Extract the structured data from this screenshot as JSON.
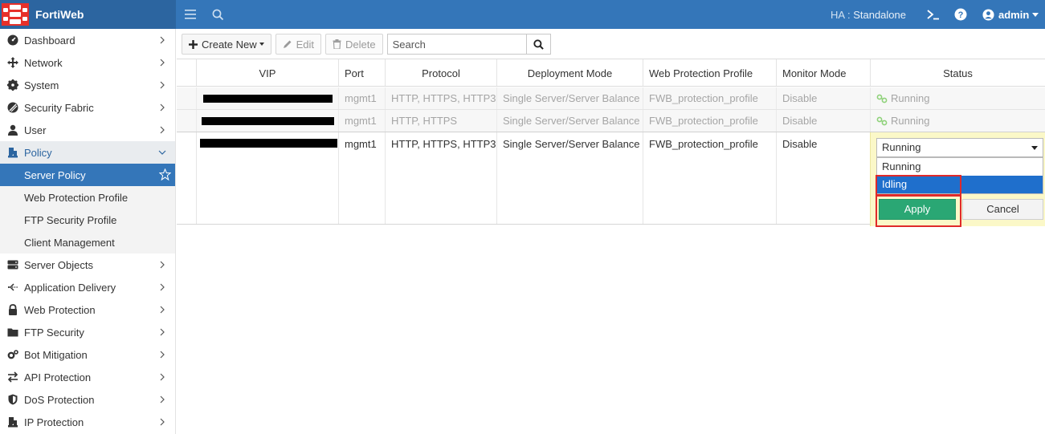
{
  "header": {
    "app_name": "FortiWeb",
    "ha_label": "HA :",
    "ha_value": "Standalone",
    "user": "admin"
  },
  "sidebar": {
    "items": [
      {
        "label": "Dashboard",
        "icon": "dashboard-icon"
      },
      {
        "label": "Network",
        "icon": "network-icon"
      },
      {
        "label": "System",
        "icon": "gear-icon"
      },
      {
        "label": "Security Fabric",
        "icon": "security-fabric-icon"
      },
      {
        "label": "User",
        "icon": "user-icon"
      },
      {
        "label": "Policy",
        "icon": "policy-icon"
      },
      {
        "label": "Server Objects",
        "icon": "server-icon"
      },
      {
        "label": "Application Delivery",
        "icon": "application-delivery-icon"
      },
      {
        "label": "Web Protection",
        "icon": "lock-icon"
      },
      {
        "label": "FTP Security",
        "icon": "folder-icon"
      },
      {
        "label": "Bot Mitigation",
        "icon": "gears-icon"
      },
      {
        "label": "API Protection",
        "icon": "exchange-icon"
      },
      {
        "label": "DoS Protection",
        "icon": "shield-icon"
      },
      {
        "label": "IP Protection",
        "icon": "ip-protection-icon"
      }
    ],
    "policy_sub": [
      {
        "label": "Server Policy"
      },
      {
        "label": "Web Protection Profile"
      },
      {
        "label": "FTP Security Profile"
      },
      {
        "label": "Client Management"
      }
    ]
  },
  "toolbar": {
    "create_new": "Create New",
    "edit": "Edit",
    "delete": "Delete",
    "search_placeholder": "Search"
  },
  "table": {
    "columns": [
      "VIP",
      "Port",
      "Protocol",
      "Deployment Mode",
      "Web Protection Profile",
      "Monitor Mode",
      "Status"
    ],
    "rows": [
      {
        "vip": "",
        "port": "mgmt1",
        "protocol": "HTTP, HTTPS, HTTP3",
        "deployment_mode": "Single Server/Server Balance",
        "profile": "FWB_protection_profile",
        "monitor_mode": "Disable",
        "status": "Running"
      },
      {
        "vip": "",
        "port": "mgmt1",
        "protocol": "HTTP, HTTPS",
        "deployment_mode": "Single Server/Server Balance",
        "profile": "FWB_protection_profile",
        "monitor_mode": "Disable",
        "status": "Running"
      },
      {
        "vip": "",
        "port": "mgmt1",
        "protocol": "HTTP, HTTPS, HTTP3",
        "deployment_mode": "Single Server/Server Balance",
        "profile": "FWB_protection_profile",
        "monitor_mode": "Disable",
        "status": "Running"
      }
    ]
  },
  "status_editor": {
    "selected": "Running",
    "options": [
      "Running",
      "Idling"
    ],
    "highlighted": "Idling",
    "apply": "Apply",
    "cancel": "Cancel"
  },
  "colors": {
    "header_bg": "#3476b9",
    "brand_bg": "#2c65a0",
    "selected_nav": "#3476b9",
    "apply_green": "#2aa774",
    "highlight_blue": "#1f6fcc",
    "annotation_red": "#e02a2a",
    "editor_yellow": "#fbf8c8"
  }
}
